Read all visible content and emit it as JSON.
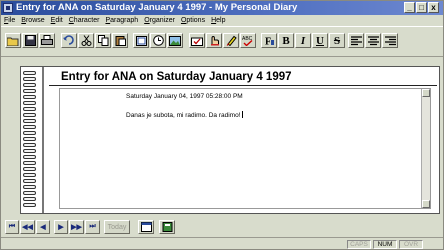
{
  "window": {
    "title": "Entry for ANA on Saturday January 4 1997 - My Personal Diary",
    "buttons": {
      "minimize": "_",
      "maximize": "□",
      "close": "x"
    }
  },
  "menu": [
    "File",
    "Browse",
    "Edit",
    "Character",
    "Paragraph",
    "Organizer",
    "Options",
    "Help"
  ],
  "toolbar": {
    "bold": "B",
    "italic": "I",
    "underline": "U",
    "strike": "S"
  },
  "entry": {
    "heading": "Entry for ANA on Saturday January 4 1997",
    "timestamp": "Saturday January 04, 1997 05:28:00 PM",
    "body": "Danas je subota, mi radimo. Da radimo!"
  },
  "navigation": {
    "first": "⏮",
    "prev_many": "◀◀",
    "prev": "◀",
    "next": "▶",
    "next_many": "▶▶",
    "last": "⏭",
    "today": "Today"
  },
  "status": {
    "caps": "CAPS",
    "num": "NUM",
    "ovr": "OVR"
  }
}
